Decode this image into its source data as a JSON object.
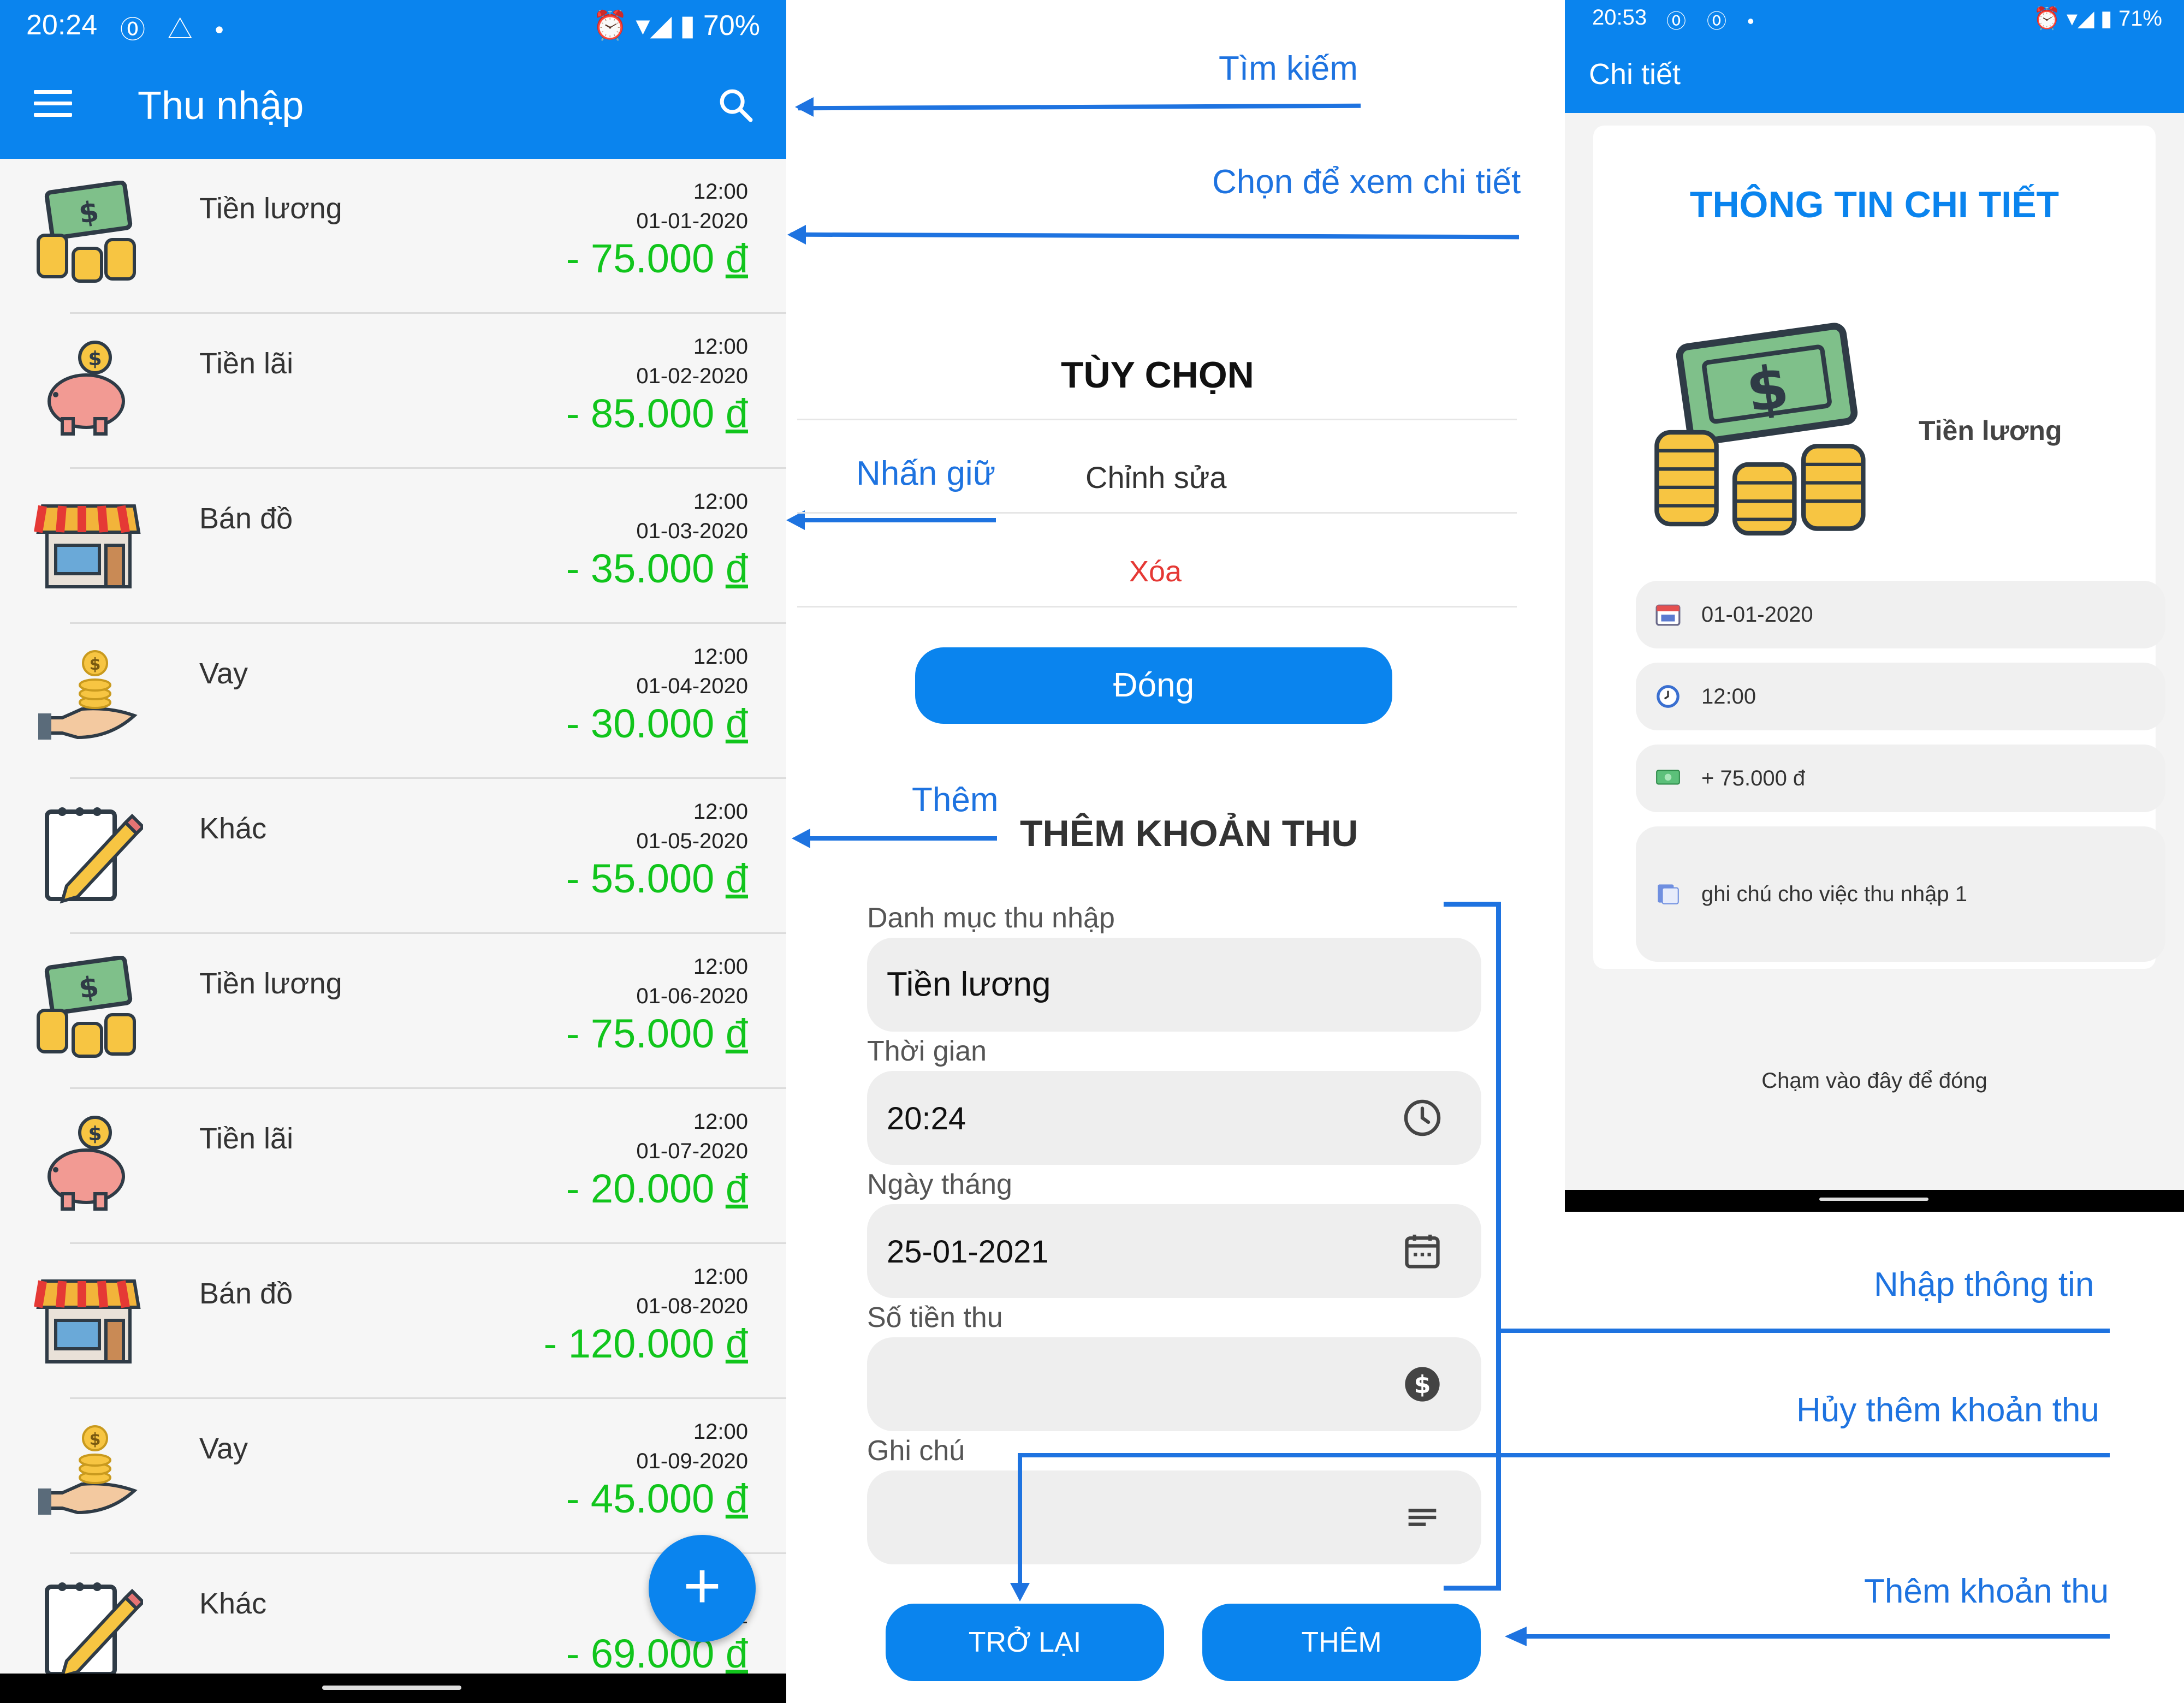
{
  "income_list_screen": {
    "status": {
      "time": "20:24",
      "battery": "70%"
    },
    "title": "Thu nhập",
    "currency_symbol": "đ",
    "items": [
      {
        "category": "Tiền lương",
        "icon": "money-coins-icon",
        "time": "12:00",
        "date": "01-01-2020",
        "amount": "- 75.000"
      },
      {
        "category": "Tiền lãi",
        "icon": "piggy-bank-icon",
        "time": "12:00",
        "date": "01-02-2020",
        "amount": "- 85.000"
      },
      {
        "category": "Bán đồ",
        "icon": "shop-icon",
        "time": "12:00",
        "date": "01-03-2020",
        "amount": "- 35.000"
      },
      {
        "category": "Vay",
        "icon": "hand-coins-icon",
        "time": "12:00",
        "date": "01-04-2020",
        "amount": "- 30.000"
      },
      {
        "category": "Khác",
        "icon": "notepad-pencil-icon",
        "time": "12:00",
        "date": "01-05-2020",
        "amount": "- 55.000"
      },
      {
        "category": "Tiền lương",
        "icon": "money-coins-icon",
        "time": "12:00",
        "date": "01-06-2020",
        "amount": "- 75.000"
      },
      {
        "category": "Tiền lãi",
        "icon": "piggy-bank-icon",
        "time": "12:00",
        "date": "01-07-2020",
        "amount": "- 20.000"
      },
      {
        "category": "Bán đồ",
        "icon": "shop-icon",
        "time": "12:00",
        "date": "01-08-2020",
        "amount": "- 120.000"
      },
      {
        "category": "Vay",
        "icon": "hand-coins-icon",
        "time": "12:00",
        "date": "01-09-2020",
        "amount": "- 45.000"
      },
      {
        "category": "Khác",
        "icon": "notepad-pencil-icon",
        "time": "12:00",
        "date": "01",
        "amount": "- 69.000"
      }
    ],
    "fab_label": "+"
  },
  "annotations": {
    "search": "Tìm kiếm",
    "select_detail": "Chọn để xem chi tiết",
    "long_press": "Nhấn giữ",
    "add": "Thêm",
    "enter_info": "Nhập thông tin",
    "cancel_add": "Hủy thêm khoản thu",
    "add_income": "Thêm khoản thu"
  },
  "options_dialog": {
    "title": "TÙY CHỌN",
    "edit": "Chỉnh sửa",
    "delete": "Xóa",
    "close": "Đóng"
  },
  "add_form": {
    "title": "THÊM KHOẢN THU",
    "category_label": "Danh mục thu nhập",
    "category_value": "Tiền lương",
    "time_label": "Thời gian",
    "time_value": "20:24",
    "date_label": "Ngày tháng",
    "date_value": "25-01-2021",
    "amount_label": "Số tiền thu",
    "amount_value": "",
    "note_label": "Ghi chú",
    "note_value": "",
    "back_button": "TRỞ LẠI",
    "add_button": "THÊM"
  },
  "detail_screen": {
    "status": {
      "time": "20:53",
      "battery": "71%"
    },
    "appbar_title": "Chi tiết",
    "heading": "THÔNG TIN CHI TIẾT",
    "category": "Tiền lương",
    "date": "01-01-2020",
    "time": "12:00",
    "amount": "+ 75.000 đ",
    "note": "ghi chú cho việc thu nhập 1",
    "close_hint": "Chạm vào đây để đóng"
  },
  "colors": {
    "primary": "#0a84ee",
    "amount_green": "#11c51c",
    "delete_red": "#e53935",
    "annotation_blue": "#1e73e0"
  }
}
